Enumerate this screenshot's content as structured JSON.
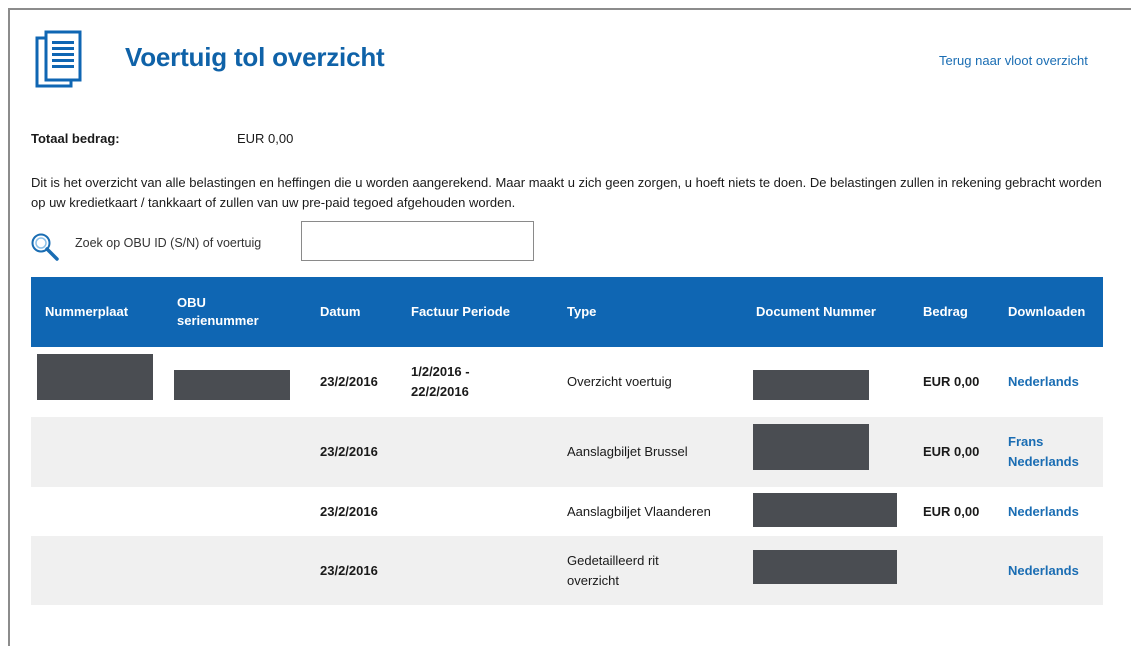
{
  "header": {
    "title": "Voertuig tol overzicht",
    "back_link": "Terug naar vloot overzicht"
  },
  "summary": {
    "total_label": "Totaal bedrag:",
    "total_value": "EUR 0,00"
  },
  "description": "Dit is het overzicht van alle belastingen en heffingen die u worden aangerekend. Maar maakt u zich geen zorgen, u hoeft niets te doen. De belastingen zullen in rekening gebracht worden op uw kredietkaart / tankkaart of zullen van uw pre-paid tegoed afgehouden worden.",
  "search": {
    "label": "Zoek op OBU ID (S/N) of voertuig",
    "value": ""
  },
  "table": {
    "columns": [
      "Nummerplaat",
      "OBU serienummer",
      "Datum",
      "Factuur Periode",
      "Type",
      "Document Nummer",
      "Bedrag",
      "Downloaden"
    ],
    "rows": [
      {
        "plate": "",
        "obu": "",
        "date": "23/2/2016",
        "period": "1/2/2016 - 22/2/2016",
        "type": "Overzicht voertuig",
        "doc": "",
        "amount": "EUR 0,00",
        "downloads": [
          "Nederlands"
        ]
      },
      {
        "plate": "",
        "obu": "",
        "date": "23/2/2016",
        "period": "",
        "type": "Aanslagbiljet Brussel",
        "doc": "",
        "amount": "EUR 0,00",
        "downloads": [
          "Frans",
          "Nederlands"
        ]
      },
      {
        "plate": "",
        "obu": "",
        "date": "23/2/2016",
        "period": "",
        "type": "Aanslagbiljet Vlaanderen",
        "doc": "",
        "amount": "EUR 0,00",
        "downloads": [
          "Nederlands"
        ]
      },
      {
        "plate": "",
        "obu": "",
        "date": "23/2/2016",
        "period": "",
        "type": "Gedetailleerd rit overzicht",
        "doc": "",
        "amount": "",
        "downloads": [
          "Nederlands"
        ]
      }
    ]
  },
  "colors": {
    "accent": "#0f66b3",
    "title": "#0f62a8",
    "link": "#1a6db3",
    "row_alt": "#f0f0f0",
    "redaction": "#4a4d52"
  },
  "icons": {
    "header": "document-icon",
    "search": "magnifier-icon"
  }
}
